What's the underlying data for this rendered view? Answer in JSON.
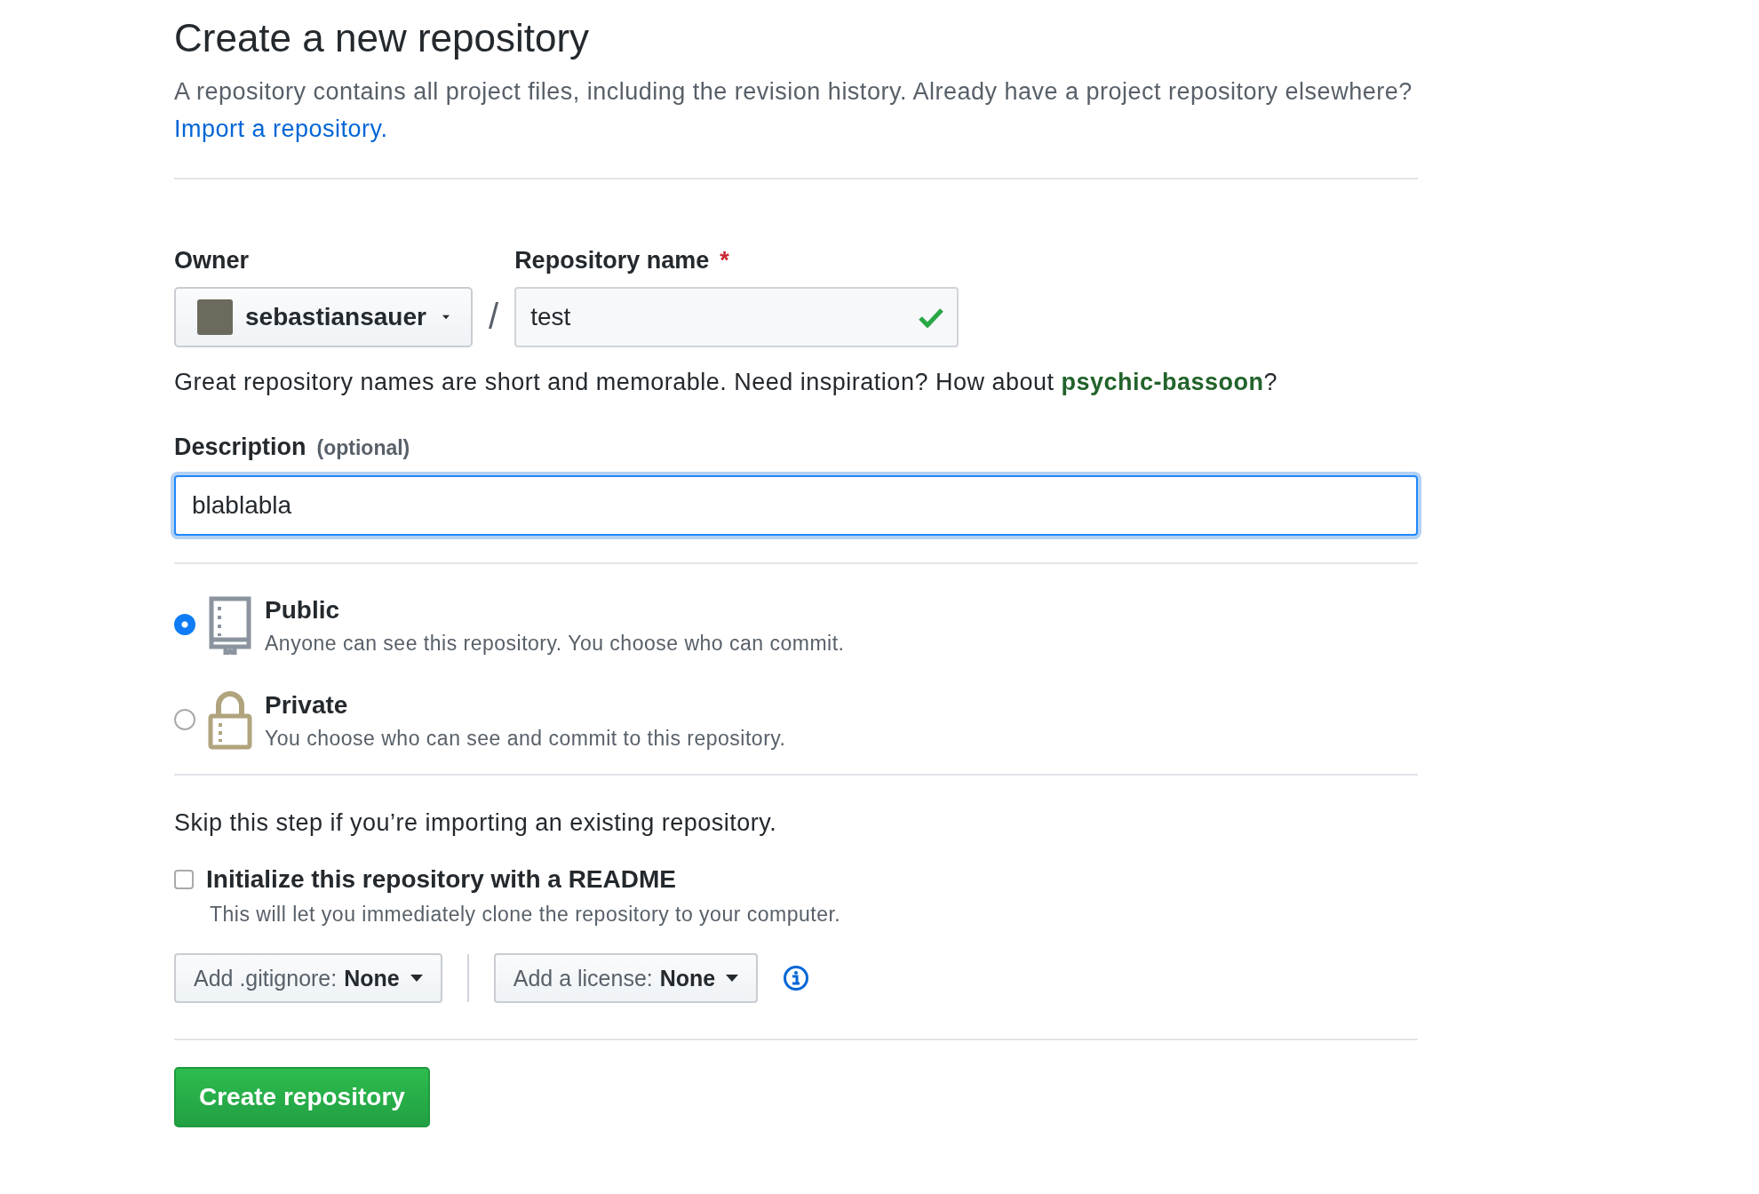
{
  "title": "Create a new repository",
  "intro": {
    "text": "A repository contains all project files, including the revision history. Already have a project repository elsewhere?",
    "link": "Import a repository."
  },
  "owner": {
    "label": "Owner",
    "value": "sebastiansauer"
  },
  "separator": "/",
  "repo_name": {
    "label": "Repository name",
    "required_mark": "*",
    "value": "test",
    "valid": true
  },
  "name_hint": {
    "before": "Great repository names are short and memorable. Need inspiration? How about",
    "suggestion": "psychic-bassoon",
    "after": "?"
  },
  "description": {
    "label": "Description",
    "note": "(optional)",
    "value": "blablabla",
    "focused": true
  },
  "visibility": [
    {
      "kind": "public",
      "label": "Public",
      "text": "Anyone can see this repository. You choose who can commit.",
      "selected": true
    },
    {
      "kind": "private",
      "label": "Private",
      "text": "You choose who can see and commit to this repository.",
      "selected": false
    }
  ],
  "skip_note": "Skip this step if you’re importing an existing repository.",
  "readme": {
    "label": "Initialize this repository with a README",
    "text": "This will let you immediately clone the repository to your computer.",
    "checked": false
  },
  "dropdowns": [
    {
      "label": "Add .gitignore:",
      "value": "None"
    },
    {
      "label": "Add a license:",
      "value": "None"
    }
  ],
  "submit": "Create repository"
}
